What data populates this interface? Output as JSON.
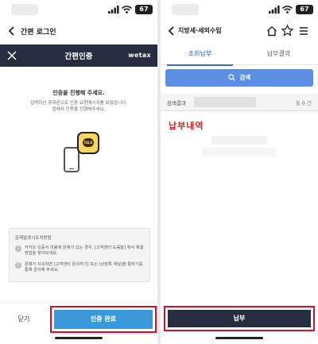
{
  "left": {
    "status": {
      "battery": "67"
    },
    "topbar": {
      "title": "간편 로그인"
    },
    "header": {
      "title": "간편인증",
      "logo": "wetax"
    },
    "auth": {
      "heading": "인증을 진행해 주세요.",
      "desc_line1": "입력하신 휴대폰으로 인증 요청메시지를 보냈습니다.",
      "desc_line2": "앱에서 인증을 진행해주세요.",
      "talk_label": "TALK"
    },
    "guide": {
      "title": "문제발생시조치방법",
      "items": [
        {
          "num": "1",
          "text": "카카오 인증서 이용에 문제가 있는 경우, [고객센터 도움말] 에서 해결 방법을 찾아보세요."
        },
        {
          "num": "2",
          "text": "문제가 지속되면 [고객센터 문의하기] 또는 [상담톡 채널]을 통하기를 통해 문의해 주세요."
        }
      ]
    },
    "footer": {
      "close_label": "닫기",
      "confirm_label": "인증 완료"
    }
  },
  "right": {
    "status": {
      "battery": "67"
    },
    "topbar": {
      "title": "지방세·세외수입"
    },
    "tabs": [
      {
        "label": "조회납부",
        "active": true
      },
      {
        "label": "납부결과",
        "active": false
      }
    ],
    "search": {
      "label": "검색"
    },
    "result": {
      "label": "검색결과",
      "count_prefix": "총",
      "count": "0",
      "count_suffix": "건"
    },
    "annotation": "납부내역",
    "footer": {
      "pay_label": "납부"
    }
  },
  "colors": {
    "header_dark": "#262d3f",
    "confirm_blue": "#3a9ad9",
    "tab_active": "#2f6fd6",
    "search_blue": "#5a8fe3",
    "highlight_red": "#d60f28",
    "annotation_red": "#e02020",
    "kakao_yellow": "#f9d65c"
  },
  "icons": {
    "back": "chevron-left-icon",
    "close": "close-icon",
    "home": "home-icon",
    "star": "star-icon",
    "menu": "hamburger-menu-icon",
    "search": "search-icon",
    "phone": "smartphone-icon",
    "talk": "kakao-talk-icon"
  }
}
